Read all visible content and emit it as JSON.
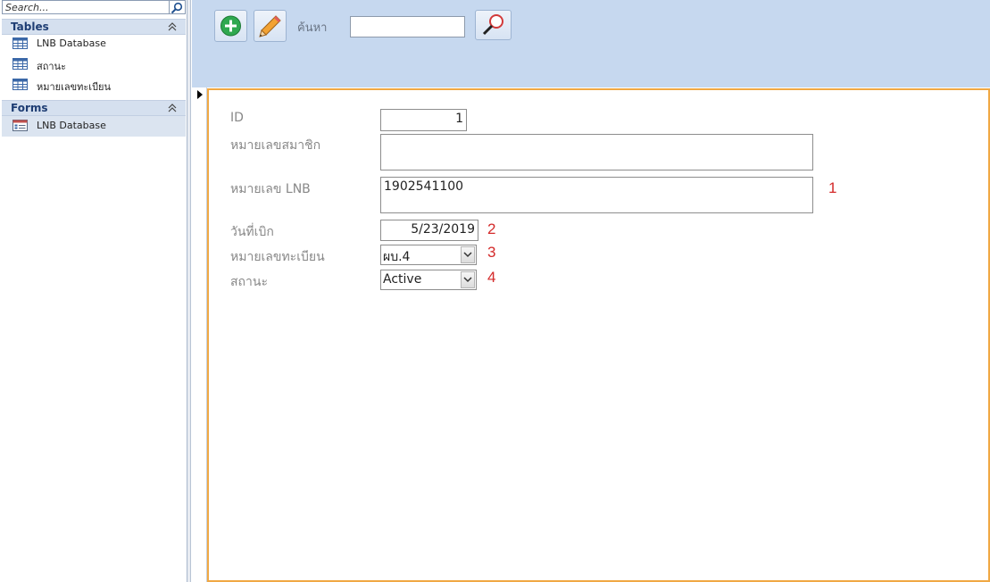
{
  "nav": {
    "search_placeholder": "Search...",
    "groups": [
      {
        "title": "Tables",
        "items": [
          {
            "label": "LNB Database",
            "icon": "table-icon"
          },
          {
            "label": "สถานะ",
            "icon": "table-icon"
          },
          {
            "label": "หมายเลขทะเบียน",
            "icon": "table-icon"
          }
        ]
      },
      {
        "title": "Forms",
        "items": [
          {
            "label": "LNB Database",
            "icon": "form-icon",
            "selected": true
          }
        ]
      }
    ]
  },
  "header": {
    "search_label": "ค้นหา",
    "search_value": "",
    "buttons": [
      "add-icon",
      "edit-icon",
      "search-icon"
    ]
  },
  "form": {
    "fields": [
      {
        "label": "ID",
        "value": "1"
      },
      {
        "label": "หมายเลขสมาชิก",
        "value": ""
      },
      {
        "label": "หมายเลข LNB",
        "value": "1902541100"
      },
      {
        "label": "วันที่เบิก",
        "value": "5/23/2019"
      },
      {
        "label": "หมายเลขทะเบียน",
        "value": "ผบ.4"
      },
      {
        "label": "สถานะ",
        "value": "Active"
      }
    ],
    "annotations": [
      "1",
      "2",
      "3",
      "4"
    ]
  },
  "colors": {
    "header_bg": "#c6d8ef",
    "detail_border": "#f0a844",
    "annotation": "#d42a2a",
    "group_title": "#1e3d73"
  }
}
